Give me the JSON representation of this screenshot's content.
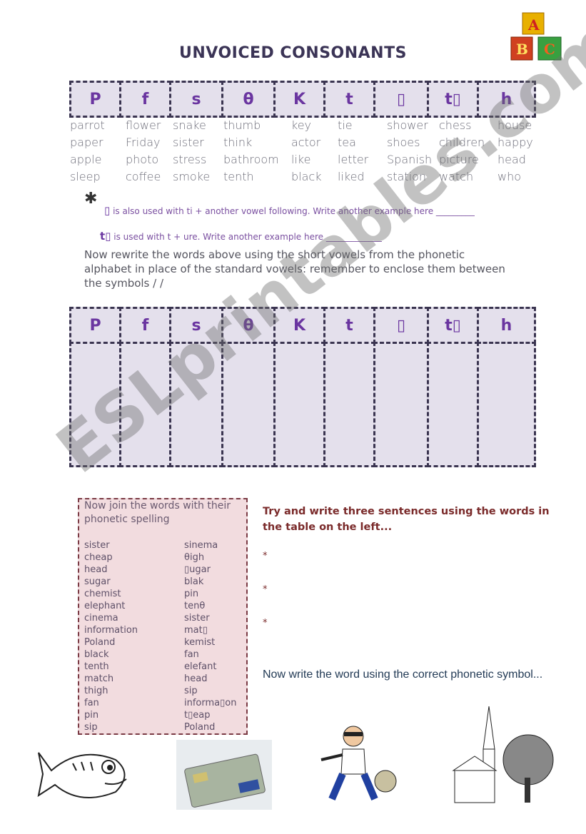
{
  "title": "UNVOICED CONSONANTS",
  "logo_text": "ABC",
  "watermark": "ESLprintables.com",
  "symbols": [
    "P",
    "f",
    "s",
    "θ",
    "K",
    "t",
    "▯",
    "t▯",
    "h"
  ],
  "words": [
    [
      "parrot",
      "paper",
      "apple",
      "sleep"
    ],
    [
      "flower",
      "Friday",
      "photo",
      "coffee"
    ],
    [
      "snake",
      "sister",
      "stress",
      "smoke"
    ],
    [
      "thumb",
      "think",
      "bathroom",
      "tenth"
    ],
    [
      "key",
      "actor",
      "like",
      "black"
    ],
    [
      "tie",
      "tea",
      "letter",
      "liked"
    ],
    [
      "shower",
      "shoes",
      "Spanish",
      "station"
    ],
    [
      "chess",
      "children",
      "picture",
      "watch"
    ],
    [
      "house",
      "happy",
      "head",
      "who"
    ]
  ],
  "notes": {
    "asterisk": "✱",
    "note1_symbol": "▯",
    "note1": " is also used with ti + another vowel following. Write another example here _________",
    "note2_symbol": "t▯",
    "note2": " is used with t + ure. Write another example here _____________"
  },
  "instruction": "Now rewrite the words above using the short vowels from the phonetic alphabet in place of the standard vowels: remember to enclose them between  the symbols / /",
  "join": {
    "heading": "Now join the words with their phonetic spelling",
    "left": [
      "sister",
      "cheap",
      "head",
      "sugar",
      "chemist",
      "elephant",
      "cinema",
      "information",
      "Poland",
      "black",
      "tenth",
      "match",
      "thigh",
      "fan",
      "pin",
      "sip"
    ],
    "right": [
      "sinema",
      "θigh",
      "▯ugar",
      "blak",
      "pin",
      "tenθ",
      "sister",
      "mat▯",
      "kemist",
      "fan",
      "elefant",
      "head",
      "sip",
      "informa▯on",
      "t▯eap",
      "Poland"
    ]
  },
  "sentences": {
    "prompt": "Try and write three sentences using the words in the table on the left...",
    "bullets": [
      "*",
      "*",
      "*"
    ]
  },
  "phonetic_prompt": " Now write the word using the correct phonetic symbol...",
  "colors": {
    "accent": "#6a35a0",
    "cell_bg": "#e4e0ec",
    "join_bg": "#f2dcdf",
    "prompt": "#7a2a2a"
  }
}
